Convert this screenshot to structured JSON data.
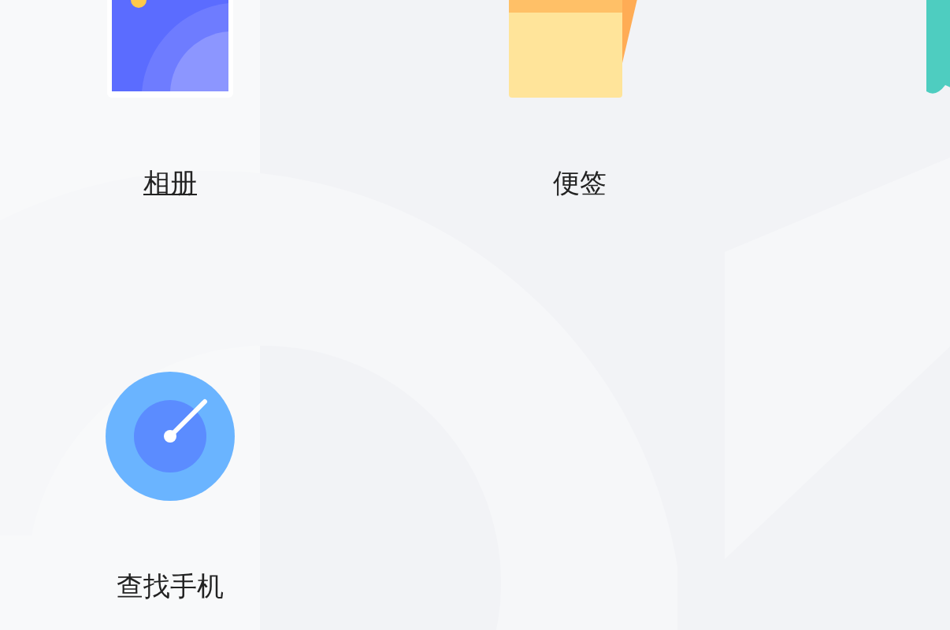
{
  "apps": [
    {
      "kind": "album",
      "label": "相册",
      "hovered": true
    },
    {
      "kind": "notes",
      "label": "便签",
      "hovered": false
    },
    {
      "kind": "bookmark"
    },
    {
      "kind": "locate",
      "label": "查找手机",
      "hovered": false
    }
  ]
}
